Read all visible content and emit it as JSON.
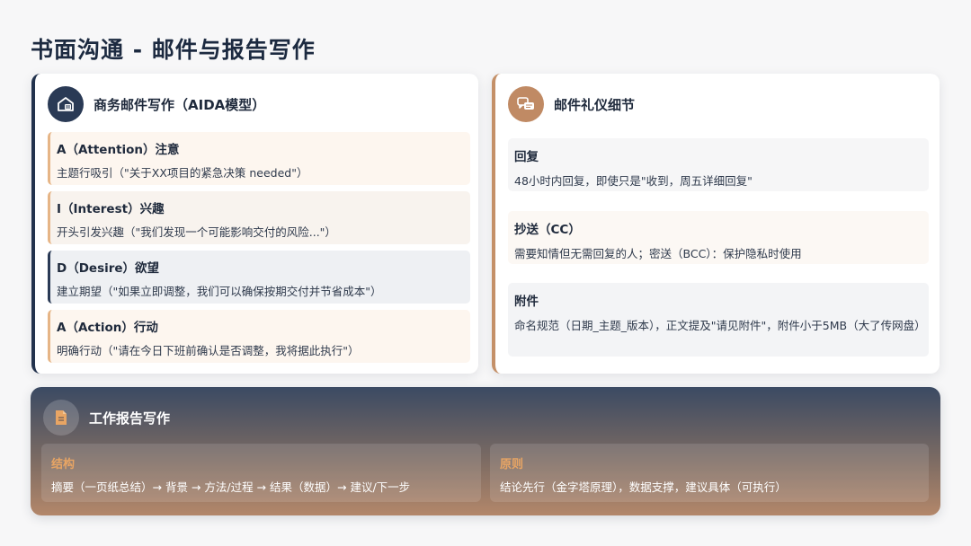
{
  "page": {
    "title": "书面沟通 - 邮件与报告写作"
  },
  "email_aida": {
    "title": "商务邮件写作（AIDA模型）",
    "icon": "envelope-badge-icon",
    "items": [
      {
        "title": "A（Attention）注意",
        "desc": "主题行吸引（\"关于XX项目的紧急决策 needed\"）"
      },
      {
        "title": "I（Interest）兴趣",
        "desc": "开头引发兴趣（\"我们发现一个可能影响交付的风险...\"）"
      },
      {
        "title": "D（Desire）欲望",
        "desc": "建立期望（\"如果立即调整，我们可以确保按期交付并节省成本\"）"
      },
      {
        "title": "A（Action）行动",
        "desc": "明确行动（\"请在今日下班前确认是否调整，我将据此执行\"）"
      }
    ]
  },
  "etiquette": {
    "title": "邮件礼仪细节",
    "icon": "chat-bubbles-icon",
    "items": [
      {
        "title": "回复",
        "desc": "48小时内回复，即使只是\"收到，周五详细回复\""
      },
      {
        "title": "抄送（CC）",
        "desc": "需要知情但无需回复的人；密送（BCC）：保护隐私时使用"
      },
      {
        "title": "附件",
        "desc": "命名规范（日期_主题_版本），正文提及\"请见附件\"，附件小于5MB（大了传网盘）"
      }
    ]
  },
  "report": {
    "title": "工作报告写作",
    "icon": "document-icon",
    "panels": [
      {
        "title": "结构",
        "desc": "摘要（一页纸总结）→ 背景 → 方法/过程 → 结果（数据）→ 建议/下一步"
      },
      {
        "title": "原则",
        "desc": "结论先行（金字塔原理），数据支撑，建议具体（可执行）"
      }
    ]
  },
  "colors": {
    "navy": "#22324d",
    "tan": "#c49068",
    "orange": "#e8a564"
  }
}
